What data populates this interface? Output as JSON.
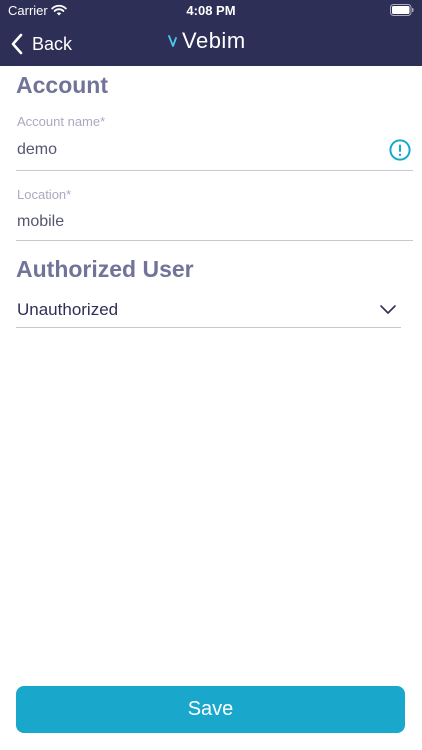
{
  "status_bar": {
    "carrier": "Carrier",
    "time": "4:08 PM"
  },
  "nav": {
    "back_label": "Back",
    "logo_text": "Vebim",
    "logo_icon": "webim-v-mark-icon"
  },
  "account": {
    "title": "Account",
    "account_name_label": "Account name*",
    "account_name_value": "demo",
    "location_label": "Location*",
    "location_value": "mobile"
  },
  "authorized_user": {
    "title": "Authorized User",
    "selected": "Unauthorized"
  },
  "save_label": "Save",
  "colors": {
    "header_bg": "#2e2f57",
    "accent": "#1aa7cc",
    "section_title": "#727399"
  }
}
